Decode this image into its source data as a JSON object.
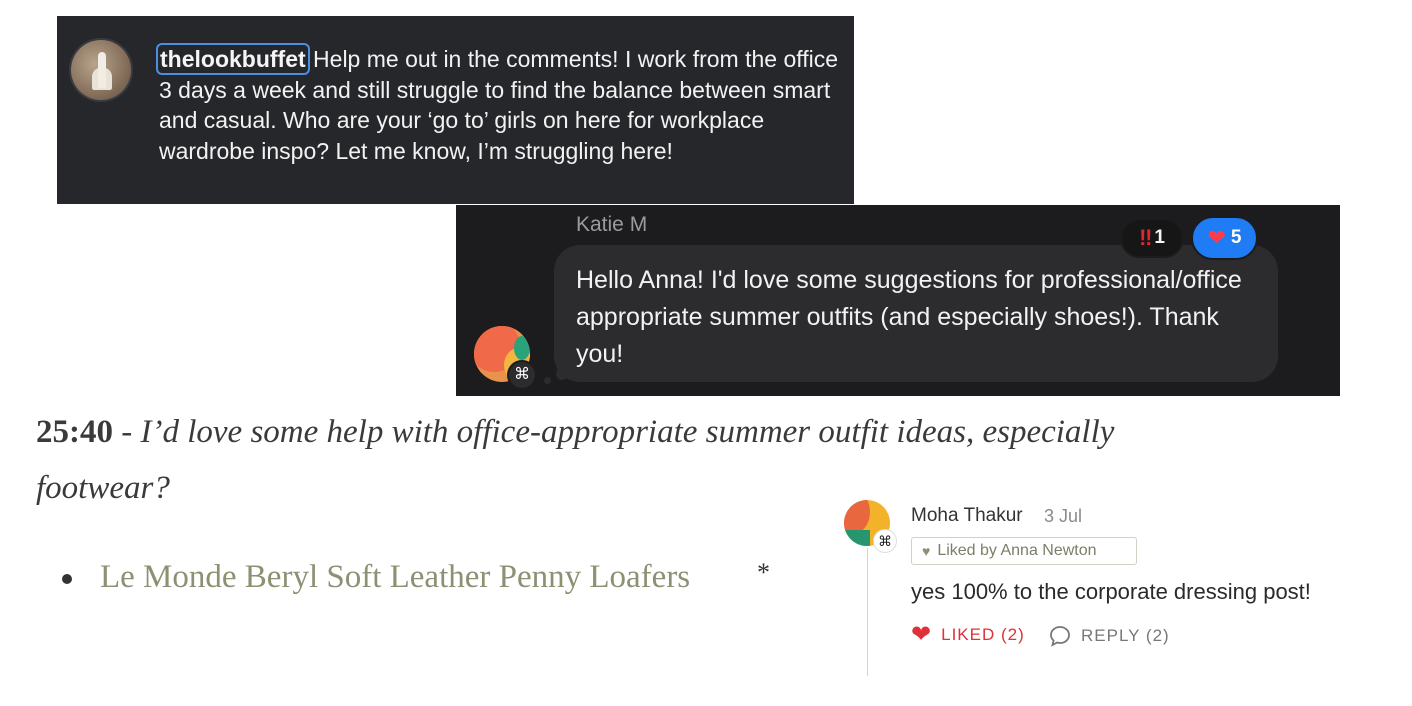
{
  "instagram": {
    "username": "thelookbuffet",
    "caption": "Help me out in the comments! I work from the office 3 days a week and still struggle to find the balance between smart and casual. Who are your ‘go to’ girls on here for workplace wardrobe inspo? Let me know, I’m struggling here!"
  },
  "chat": {
    "sender": "Katie M",
    "message": "Hello Anna! I'd love some suggestions for professional/office appropriate summer outfits (and especially shoes!). Thank you!",
    "reactions": [
      {
        "icon": "double-exclamation-icon",
        "glyph": "‼",
        "count": "1"
      },
      {
        "icon": "heart-icon",
        "glyph": "❤",
        "count": "5"
      }
    ],
    "badge_glyph": "⌘"
  },
  "article": {
    "timestamp": "25:40",
    "separator": " - ",
    "question": "I’d love some help with office-appropriate summer outfit ideas, especially footwear?",
    "product_link": "Le Monde Beryl Soft Leather Penny Loafers",
    "asterisk": "*"
  },
  "comment": {
    "author": "Moha Thakur",
    "date": "3 Jul",
    "liked_by": "Liked by Anna Newton",
    "body": "yes 100% to the corporate dressing post!",
    "like_label": "LIKED (2)",
    "reply_label": "REPLY (2)",
    "badge_glyph": "⌘"
  },
  "colors": {
    "instagram_bg": "#26272b",
    "chat_bg": "#1c1c1e",
    "bubble_bg": "#2c2c2e",
    "heart_reaction_bg": "#1f7cf5",
    "link_olive": "#8d9073",
    "liked_red": "#e0303a"
  }
}
